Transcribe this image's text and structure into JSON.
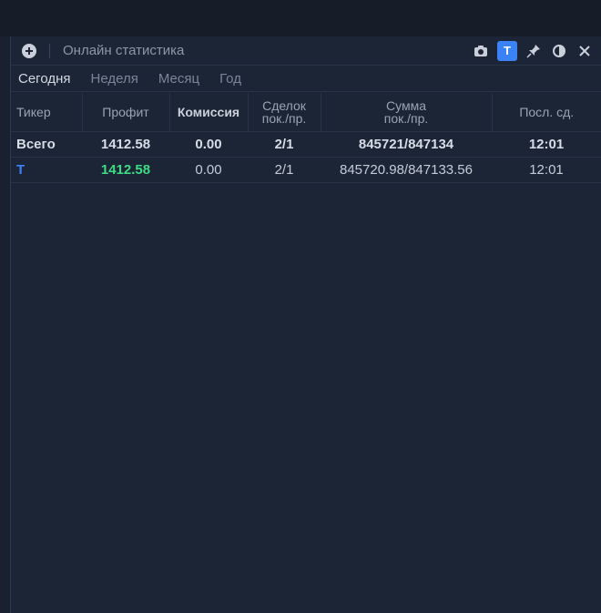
{
  "window": {
    "title": "Онлайн статистика"
  },
  "tabs": [
    {
      "label": "Сегодня",
      "active": true
    },
    {
      "label": "Неделя",
      "active": false
    },
    {
      "label": "Месяц",
      "active": false
    },
    {
      "label": "Год",
      "active": false
    }
  ],
  "toolbar": {
    "badge_label": "T",
    "icons": [
      "camera-icon",
      "pin-icon",
      "theme-icon",
      "close-icon"
    ]
  },
  "table": {
    "headers": {
      "ticker": "Тикер",
      "profit": "Профит",
      "commission": "Комиссия",
      "deals_l1": "Сделок",
      "deals_l2": "пок./пр.",
      "sum_l1": "Сумма",
      "sum_l2": "пок./пр.",
      "last": "Посл. сд."
    },
    "rows": [
      {
        "ticker": "Всего",
        "profit": "1412.58",
        "commission": "0.00",
        "deals": "2/1",
        "sum": "845721/847134",
        "last": "12:01"
      },
      {
        "ticker": "T",
        "profit": "1412.58",
        "commission": "0.00",
        "deals": "2/1",
        "sum": "845720.98/847133.56",
        "last": "12:01"
      }
    ]
  },
  "colors": {
    "accent": "#3b82f6",
    "profit": "#3ddc84",
    "background": "#1c2535"
  }
}
